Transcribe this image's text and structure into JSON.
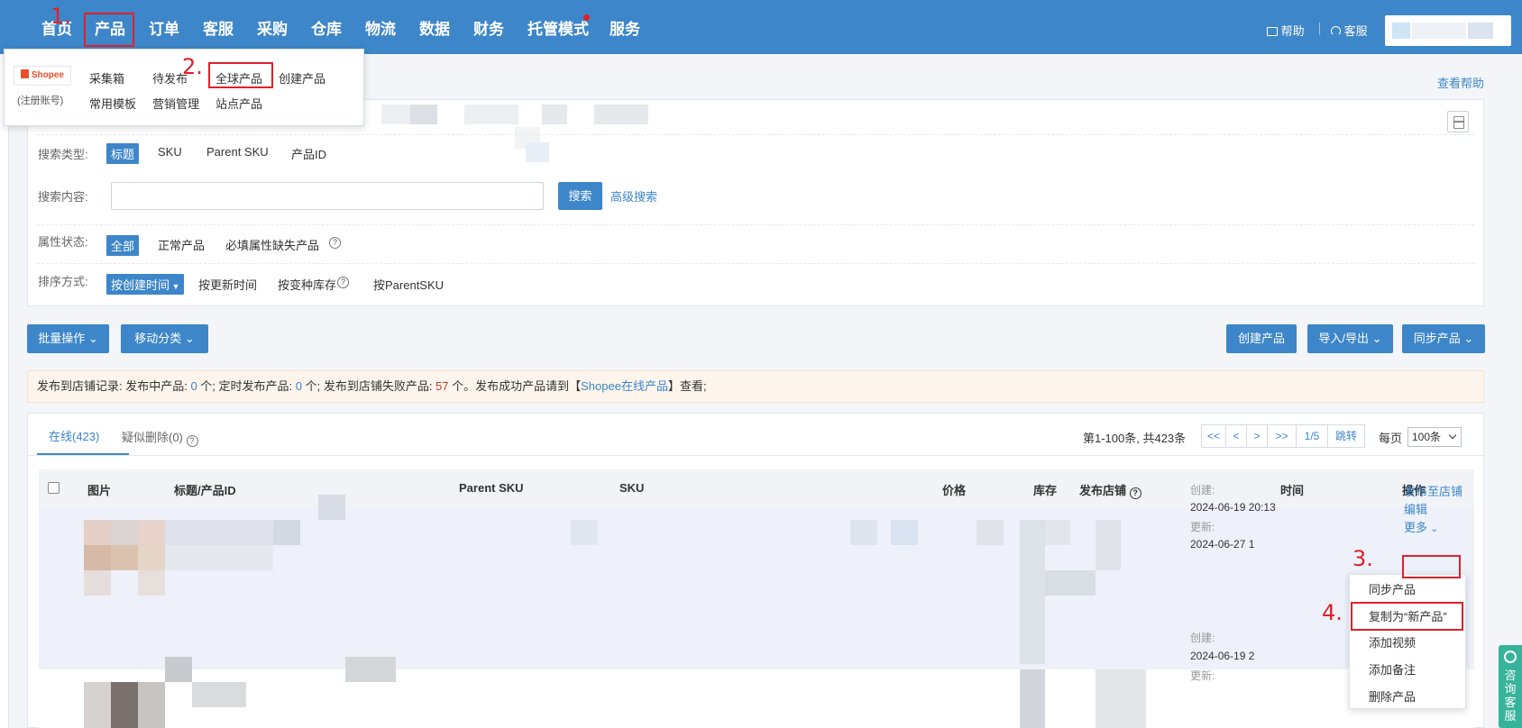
{
  "nav": {
    "items": [
      "首页",
      "产品",
      "订单",
      "客服",
      "采购",
      "仓库",
      "物流",
      "数据",
      "财务",
      "托管模式",
      "服务"
    ],
    "help": "帮助",
    "service": "客服"
  },
  "product_menu": {
    "platform": "Shopee",
    "platform_note": "(注册账号)",
    "row1": [
      "采集箱",
      "待发布",
      "全球产品",
      "创建产品"
    ],
    "row2": [
      "常用模板",
      "营销管理",
      "站点产品"
    ]
  },
  "page": {
    "help_link": "查看帮助"
  },
  "search": {
    "type_label": "搜索类型:",
    "type_options": [
      "标题",
      "SKU",
      "Parent SKU",
      "产品ID"
    ],
    "content_label": "搜索内容:",
    "content_value": "",
    "search_button": "搜索",
    "advanced_link": "高级搜索",
    "attr_label": "属性状态:",
    "attr_options": [
      "全部",
      "正常产品",
      "必填属性缺失产品"
    ],
    "sort_label": "排序方式:",
    "sort_options": [
      "按创建时间",
      "按更新时间",
      "按变种库存",
      "按ParentSKU"
    ]
  },
  "toolbar": {
    "batch": "批量操作",
    "move": "移动分类",
    "create": "创建产品",
    "import_export": "导入/导出",
    "sync": "同步产品"
  },
  "notice": {
    "p1": "发布到店铺记录:  发布中产品: ",
    "publishing": "0",
    "p2": " 个;  定时发布产品: ",
    "scheduled": "0",
    "p3": " 个;  发布到店铺失败产品: ",
    "failed": "57",
    "p4": " 个。发布成功产品请到【",
    "link": "Shopee在线产品",
    "p5": "】查看;"
  },
  "list": {
    "tab_online": "在线(423)",
    "tab_deleted": "疑似删除(0)",
    "range": "第1-100条, 共423条",
    "pager": [
      "<<",
      "<",
      ">",
      ">>",
      "1/5",
      "跳转"
    ],
    "per_page_label": "每页",
    "per_page": "100条",
    "columns": [
      "图片",
      "标题/产品ID",
      "Parent SKU",
      "SKU",
      "价格",
      "库存",
      "发布店铺",
      "时间",
      "操作"
    ]
  },
  "rows": [
    {
      "created_label": "创建:",
      "created": "2024-06-19 20:13",
      "updated_label": "更新:",
      "updated": "2024-06-27 1",
      "ops": [
        "发布至店铺",
        "编辑",
        "更多"
      ]
    },
    {
      "created_label": "创建:",
      "created": "2024-06-19 2",
      "updated_label": "更新:",
      "ops": [
        "更多"
      ]
    }
  ],
  "more_menu": [
    "同步产品",
    "复制为“新产品”",
    "添加视频",
    "添加备注",
    "删除产品"
  ],
  "annotations": [
    "1.",
    "2.",
    "3.",
    "4."
  ],
  "side_tab": "咨询客服",
  "colors": {
    "primary": "#3d86c9",
    "annotation": "#e0202b",
    "notice_bg": "#fdf5ec",
    "side_tab": "#36b39a"
  }
}
